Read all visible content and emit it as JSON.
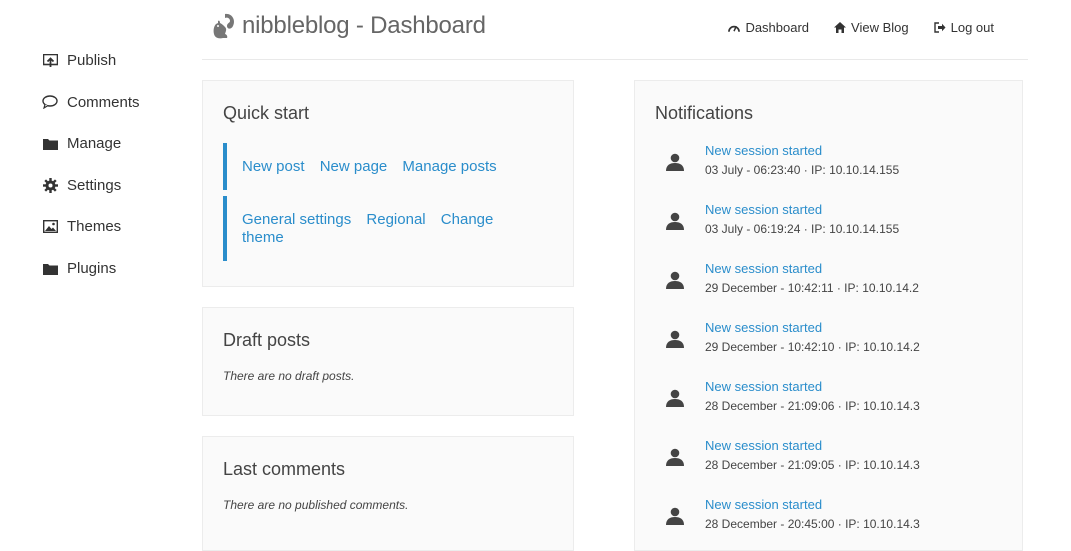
{
  "brand": {
    "title": "nibbleblog - Dashboard"
  },
  "topnav": {
    "dashboard": "Dashboard",
    "view_blog": "View Blog",
    "logout": "Log out"
  },
  "sidebar": {
    "items": [
      {
        "label": "Publish",
        "icon": "publish-icon"
      },
      {
        "label": "Comments",
        "icon": "comment-icon"
      },
      {
        "label": "Manage",
        "icon": "folder-icon"
      },
      {
        "label": "Settings",
        "icon": "gear-icon"
      },
      {
        "label": "Themes",
        "icon": "image-icon"
      },
      {
        "label": "Plugins",
        "icon": "folder-icon"
      }
    ]
  },
  "quick_start": {
    "title": "Quick start",
    "row1": [
      "New post",
      "New page",
      "Manage posts"
    ],
    "row2": [
      "General settings",
      "Regional",
      "Change theme"
    ]
  },
  "draft_posts": {
    "title": "Draft posts",
    "empty": "There are no draft posts."
  },
  "last_comments": {
    "title": "Last comments",
    "empty": "There are no published comments."
  },
  "notifications": {
    "title": "Notifications",
    "items": [
      {
        "title": "New session started",
        "meta": "03 July - 06:23:40 · IP: 10.10.14.155"
      },
      {
        "title": "New session started",
        "meta": "03 July - 06:19:24 · IP: 10.10.14.155"
      },
      {
        "title": "New session started",
        "meta": "29 December - 10:42:11 · IP: 10.10.14.2"
      },
      {
        "title": "New session started",
        "meta": "29 December - 10:42:10 · IP: 10.10.14.2"
      },
      {
        "title": "New session started",
        "meta": "28 December - 21:09:06 · IP: 10.10.14.3"
      },
      {
        "title": "New session started",
        "meta": "28 December - 21:09:05 · IP: 10.10.14.3"
      },
      {
        "title": "New session started",
        "meta": "28 December - 20:45:00 · IP: 10.10.14.3"
      }
    ]
  },
  "colors": {
    "link": "#2a8dcb",
    "text": "#333333",
    "panel_bg": "#fafafa",
    "border": "#ececec"
  }
}
